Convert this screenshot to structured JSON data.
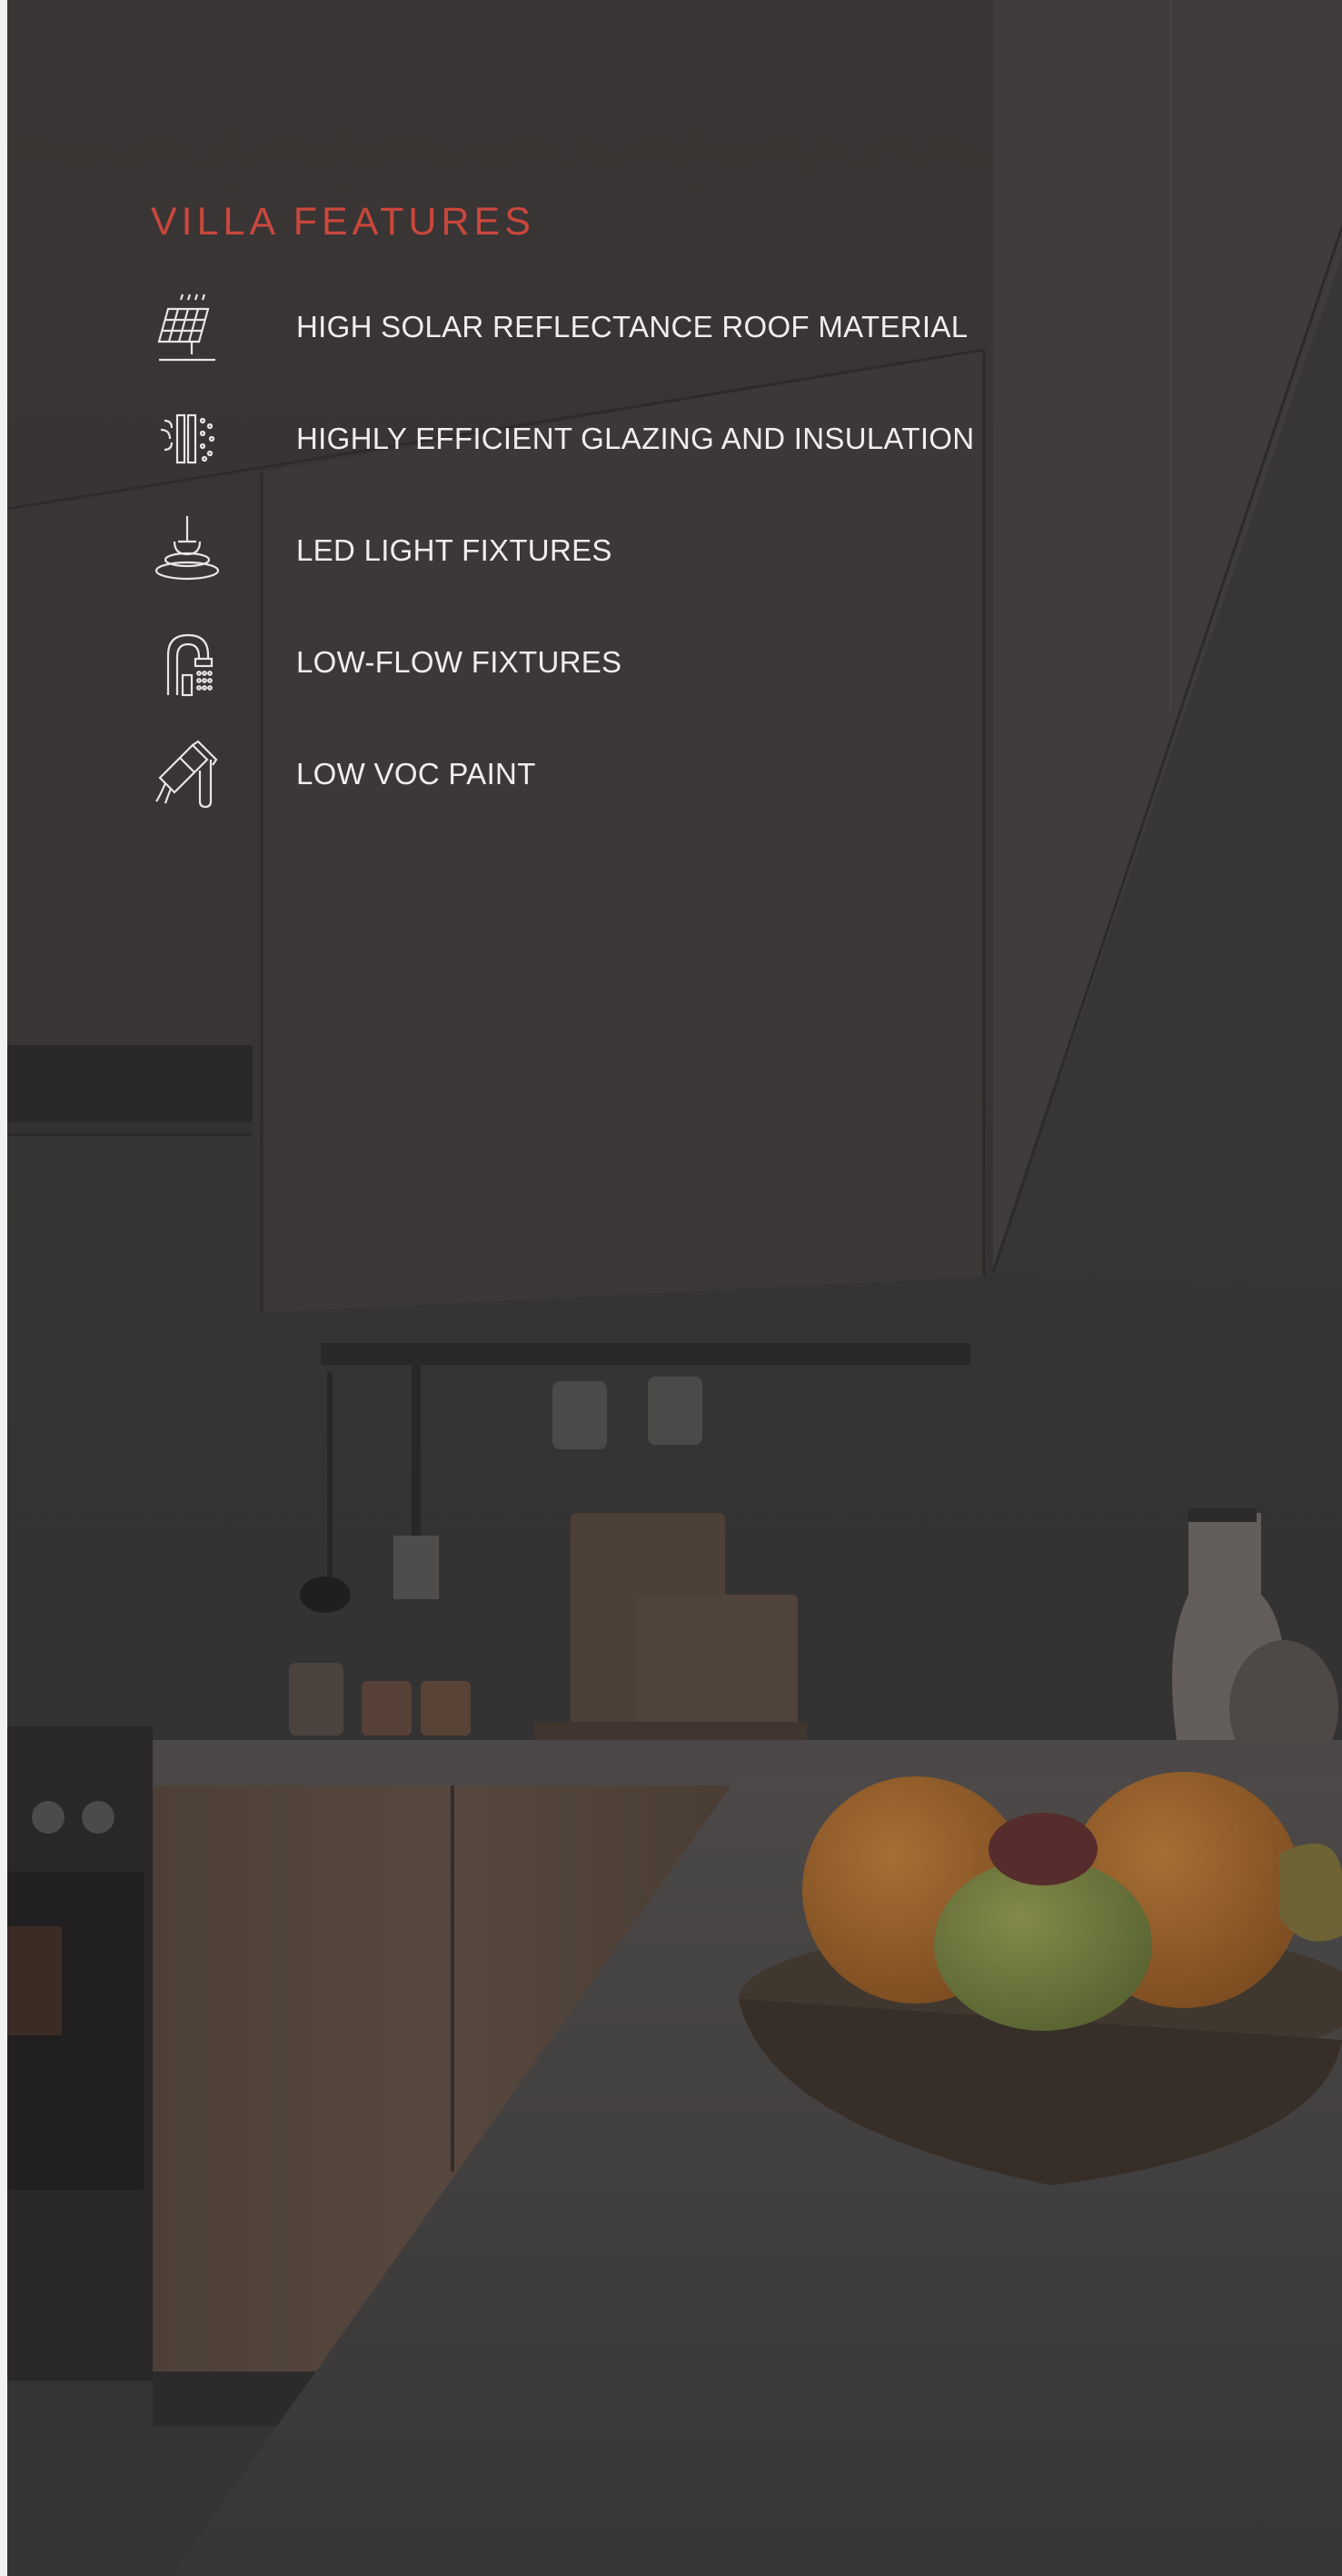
{
  "section": {
    "title": "VILLA FEATURES",
    "title_color": "#c9473c"
  },
  "features": [
    {
      "icon": "solar-panel-icon",
      "label": "HIGH SOLAR REFLECTANCE ROOF MATERIAL"
    },
    {
      "icon": "glazing-insulation-icon",
      "label": "HIGHLY EFFICIENT GLAZING AND INSULATION"
    },
    {
      "icon": "led-light-icon",
      "label": "LED LIGHT FIXTURES"
    },
    {
      "icon": "low-flow-faucet-icon",
      "label": "LOW-FLOW FIXTURES"
    },
    {
      "icon": "paint-brush-icon",
      "label": "LOW VOC PAINT"
    }
  ],
  "colors": {
    "overlay": "#3c3939",
    "text": "#f0eeec",
    "icon_stroke": "#e8e6e4"
  }
}
